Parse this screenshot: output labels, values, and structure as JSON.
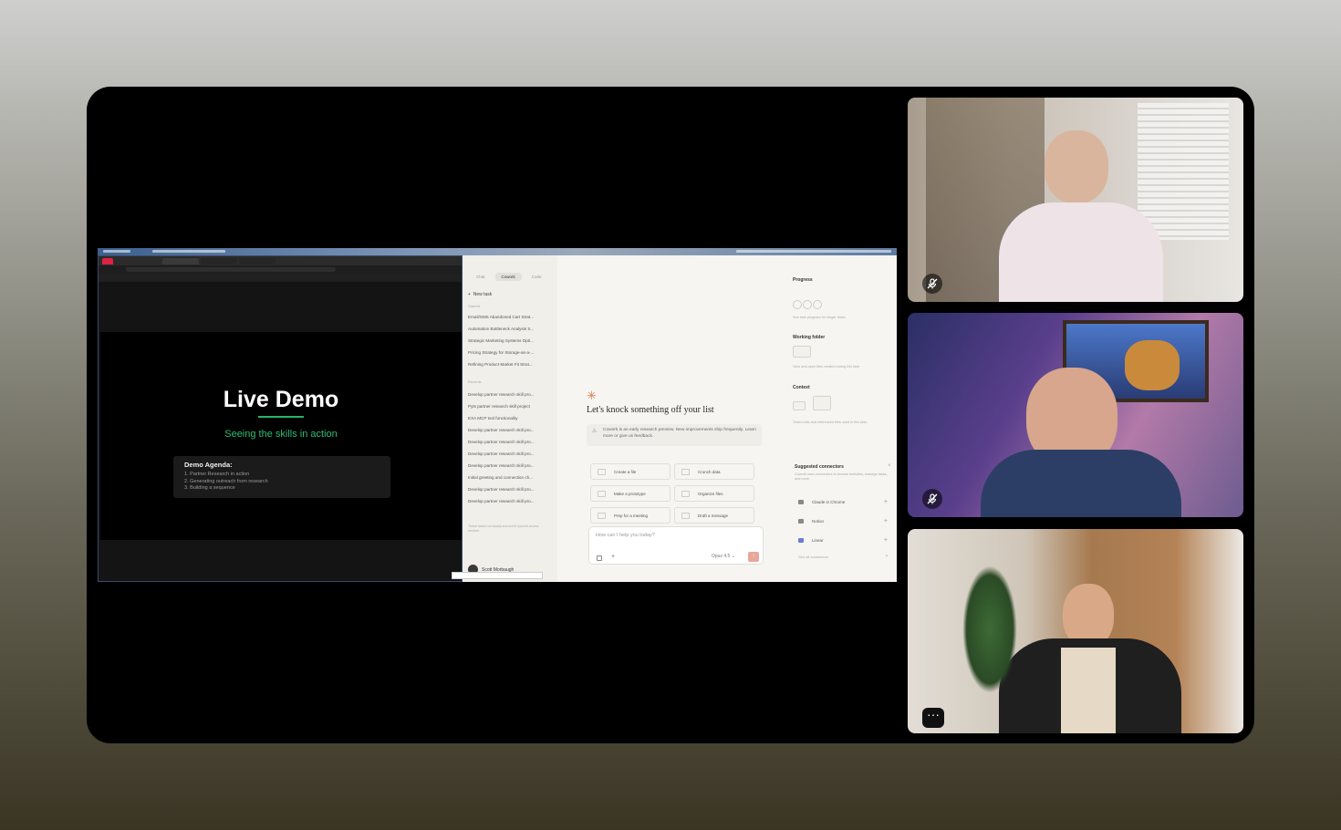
{
  "slide": {
    "title": "Live Demo",
    "subtitle": "Seeing the skills in action",
    "agenda_title": "Demo Agenda:",
    "agenda_items": [
      "1. Partner Research in action",
      "2. Generating outreach from research",
      "3. Building a sequence"
    ]
  },
  "app": {
    "tabs": [
      "Chat",
      "Cowork",
      "Code"
    ],
    "new_task": "New task",
    "starred_label": "Starred",
    "starred": [
      "Email/SMS Abandoned Cart Strat...",
      "Automation Bottleneck Analysis S...",
      "Strategic Marketing Systems Opti...",
      "Pricing Strategy for Storage-as-a-...",
      "Refining Product-Market Fit Strat..."
    ],
    "recents_label": "Recents",
    "recents": [
      "Develop partner research skill pro...",
      "Pyts partner research skill project",
      "EXA MCP tool functionality",
      "Develop partner research skill pro...",
      "Develop partner research skill pro...",
      "Develop partner research skill pro...",
      "Develop partner research skill pro...",
      "Initial greeting and connection ch...",
      "Develop partner research skill pro...",
      "Develop partner research skill pro..."
    ],
    "side_note": "These tasks run locally and aren't synced across devices",
    "user_name": "Scott Morbaugh",
    "headline": "Let's knock something off your list",
    "notice": "Cowork is an early research preview. New improvements ship frequently. Learn more or give us feedback.",
    "chips": [
      "Create a file",
      "Crunch data",
      "Make a prototype",
      "Organize files",
      "Prep for a meeting",
      "Draft a message"
    ],
    "prompt_placeholder": "How can I help you today?",
    "model": "Opus 4.5",
    "progress_title": "Progress",
    "progress_text": "See task progress for longer tasks.",
    "folder_title": "Working folder",
    "folder_text": "View and open files created during this task.",
    "context_title": "Context",
    "context_text": "Track tools and referenced files used in this task.",
    "connectors_title": "Suggested connectors",
    "connectors_text": "Cowork uses connectors to browse websites, manage tasks, and more.",
    "connectors": [
      "Claude in Chrome",
      "Notion",
      "Linear"
    ],
    "see_all": "See all connectors"
  },
  "colors": {
    "accent_green": "#2fbf73",
    "spark": "#d9774e",
    "send": "#e9a79a"
  },
  "icons": {
    "mute": "mic-off-icon",
    "more": "more-options-icon"
  }
}
